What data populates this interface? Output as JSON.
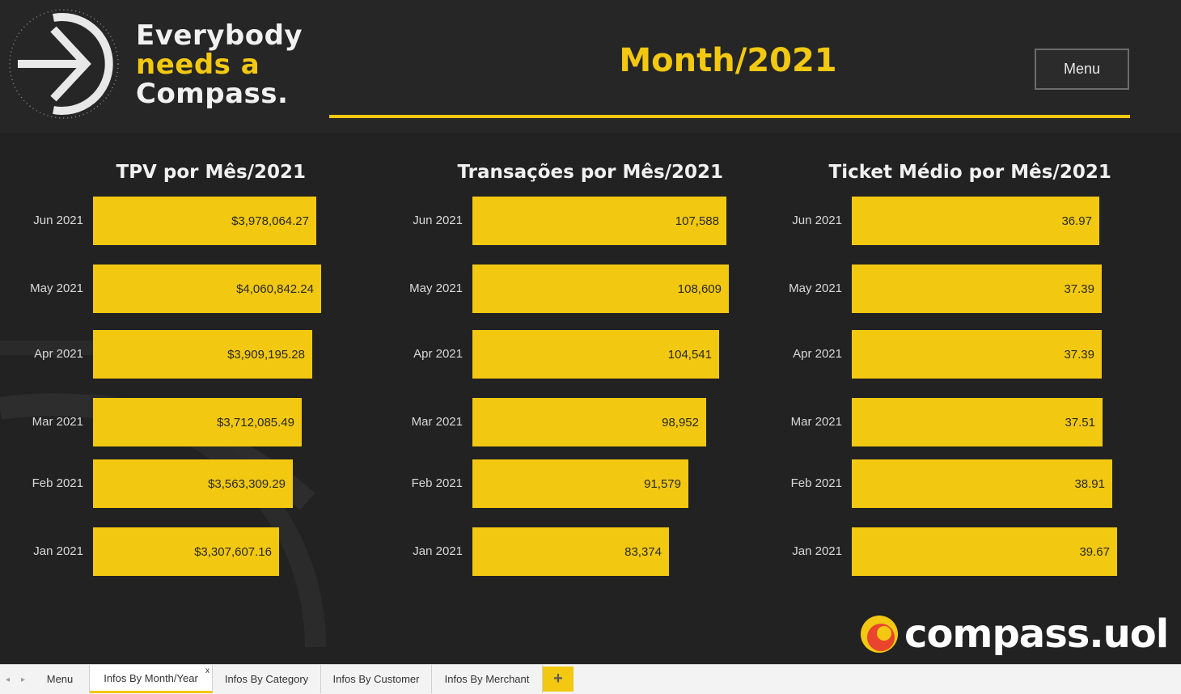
{
  "header": {
    "slogan_line1": "Everybody",
    "slogan_line2": "needs a",
    "slogan_line3": "Compass.",
    "page_title": "Month/2021",
    "menu_button": "Menu"
  },
  "colors": {
    "accent": "#f2c811",
    "background": "#222222",
    "bar_text": "#2a2a2a"
  },
  "charts": [
    {
      "title": "TPV por Mês/2021",
      "categories": [
        "Jun 2021",
        "May 2021",
        "Apr 2021",
        "Mar 2021",
        "Feb 2021",
        "Jan 2021"
      ],
      "value_labels": [
        "$3,978,064.27",
        "$4,060,842.24",
        "$3,909,195.28",
        "$3,712,085.49",
        "$3,563,309.29",
        "$3,307,607.16"
      ]
    },
    {
      "title": "Transações por Mês/2021",
      "categories": [
        "Jun 2021",
        "May 2021",
        "Apr 2021",
        "Mar 2021",
        "Feb 2021",
        "Jan 2021"
      ],
      "value_labels": [
        "107,588",
        "108,609",
        "104,541",
        "98,952",
        "91,579",
        "83,374"
      ]
    },
    {
      "title": "Ticket Médio por Mês/2021",
      "categories": [
        "Jun 2021",
        "May 2021",
        "Apr 2021",
        "Mar 2021",
        "Feb 2021",
        "Jan 2021"
      ],
      "value_labels": [
        "36.97",
        "37.39",
        "37.39",
        "37.51",
        "38.91",
        "39.67"
      ]
    }
  ],
  "chart_data": [
    {
      "type": "bar",
      "orientation": "horizontal",
      "title": "TPV por Mês/2021",
      "categories": [
        "Jun 2021",
        "May 2021",
        "Apr 2021",
        "Mar 2021",
        "Feb 2021",
        "Jan 2021"
      ],
      "values": [
        3978064.27,
        4060842.24,
        3909195.28,
        3712085.49,
        3563309.29,
        3307607.16
      ],
      "xlim": [
        0,
        4060842.24
      ],
      "grid": false
    },
    {
      "type": "bar",
      "orientation": "horizontal",
      "title": "Transações por Mês/2021",
      "categories": [
        "Jun 2021",
        "May 2021",
        "Apr 2021",
        "Mar 2021",
        "Feb 2021",
        "Jan 2021"
      ],
      "values": [
        107588,
        108609,
        104541,
        98952,
        91579,
        83374
      ],
      "xlim": [
        0,
        108609
      ],
      "grid": false
    },
    {
      "type": "bar",
      "orientation": "horizontal",
      "title": "Ticket Médio por Mês/2021",
      "categories": [
        "Jun 2021",
        "May 2021",
        "Apr 2021",
        "Mar 2021",
        "Feb 2021",
        "Jan 2021"
      ],
      "values": [
        36.97,
        37.39,
        37.39,
        37.51,
        38.91,
        39.67
      ],
      "xlim": [
        0,
        39.67
      ],
      "grid": false
    }
  ],
  "brand": {
    "logo_text": "compass.uol"
  },
  "tabs": {
    "items": [
      "Menu",
      "Infos By Month/Year",
      "Infos By Category",
      "Infos By Customer",
      "Infos By Merchant"
    ],
    "active": "Infos By Month/Year",
    "close_glyph": "x",
    "add_glyph": "+",
    "prev_glyph": "◂",
    "next_glyph": "▸"
  }
}
